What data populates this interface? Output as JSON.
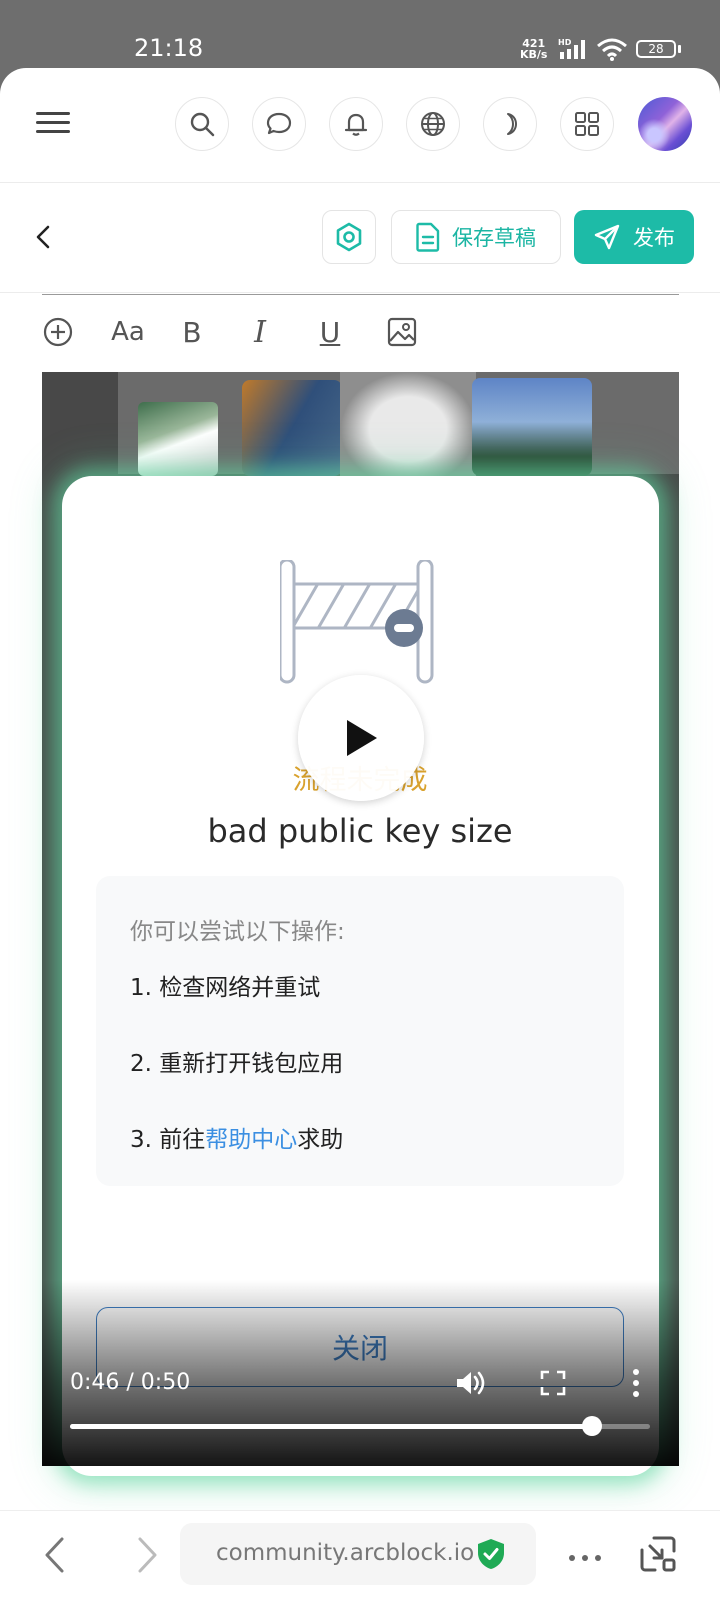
{
  "status_bar": {
    "time": "21:18",
    "net_speed_value": "421",
    "net_speed_unit": "KB/s",
    "hd_label": "HD",
    "battery_level": "28"
  },
  "top_nav": {
    "icons": [
      "menu-icon",
      "search-icon",
      "chat-icon",
      "bell-icon",
      "globe-icon",
      "moon-icon",
      "apps-grid-icon",
      "avatar"
    ]
  },
  "editor_toolbar": {
    "save_draft_label": "保存草稿",
    "publish_label": "发布"
  },
  "format_toolbar": {
    "items": [
      "add-icon",
      "font-size-icon",
      "bold-icon",
      "italic-icon",
      "underline-icon",
      "image-icon"
    ],
    "font_label": "Aa",
    "bold_label": "B",
    "italic_label": "I",
    "underline_label": "U"
  },
  "dialog": {
    "status": "流程未完成",
    "error_title": "bad public key size",
    "suggestions_title": "你可以尝试以下操作:",
    "steps": [
      "1. 检查网络并重试",
      "2. 重新打开钱包应用"
    ],
    "step3_prefix": "3. 前往",
    "step3_link": "帮助中心",
    "step3_suffix": "求助",
    "close_label": "关闭"
  },
  "video": {
    "time_readout": "0:46 / 0:50",
    "progress_fraction": 0.9
  },
  "browser_bar": {
    "url": "community.arcblock.io"
  },
  "colors": {
    "accent": "#1dbba7",
    "warning": "#d9a22e",
    "link": "#3b8fe2",
    "glow": "#60d6a0"
  }
}
